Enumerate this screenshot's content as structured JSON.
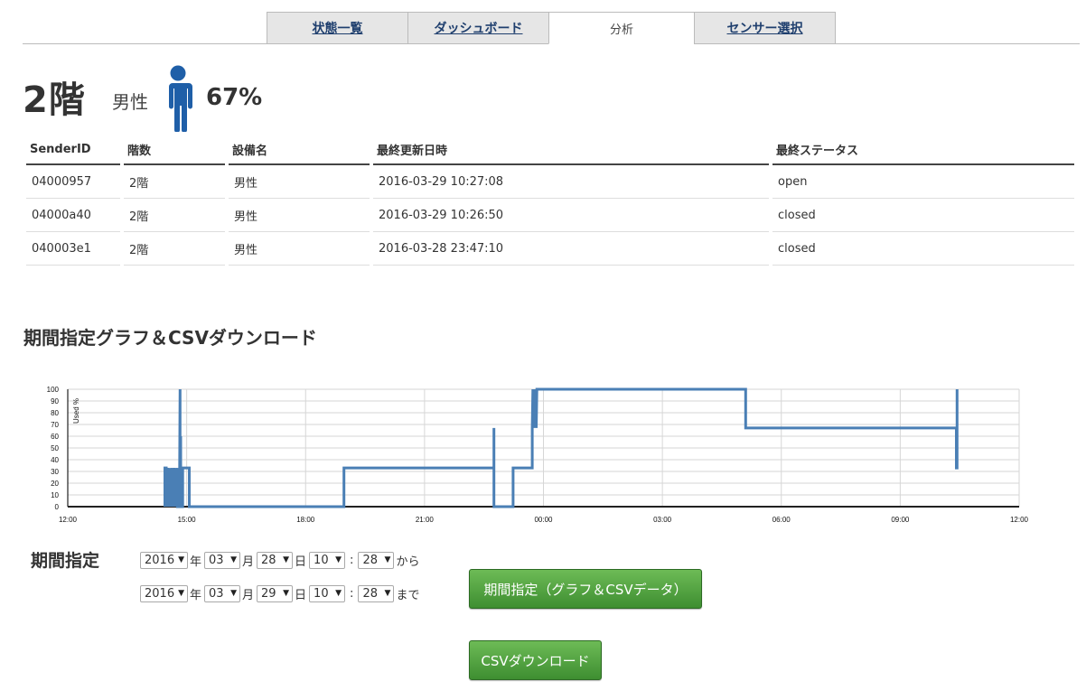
{
  "tabs": [
    {
      "label": "状態一覧"
    },
    {
      "label": "ダッシュボード"
    },
    {
      "label": "分析"
    },
    {
      "label": "センサー選択"
    }
  ],
  "header": {
    "floor": "2階",
    "gender": "男性",
    "percent": "67%"
  },
  "table": {
    "columns": [
      "SenderID",
      "階数",
      "設備名",
      "最終更新日時",
      "最終ステータス"
    ],
    "rows": [
      [
        "04000957",
        "2階",
        "男性",
        "2016-03-29 10:27:08",
        "open"
      ],
      [
        "04000a40",
        "2階",
        "男性",
        "2016-03-29 10:26:50",
        "closed"
      ],
      [
        "040003e1",
        "2階",
        "男性",
        "2016-03-28 23:47:10",
        "closed"
      ]
    ]
  },
  "section_title": "期間指定グラフ＆CSVダウンロード",
  "chart_data": {
    "type": "line",
    "ylabel": "Used %",
    "ylim": [
      0,
      100
    ],
    "yticks": [
      0,
      10,
      20,
      30,
      40,
      50,
      60,
      70,
      80,
      90,
      100
    ],
    "xlim": [
      0,
      1440
    ],
    "xticks": [
      {
        "t": 0,
        "label": "12:00"
      },
      {
        "t": 180,
        "label": "15:00"
      },
      {
        "t": 360,
        "label": "18:00"
      },
      {
        "t": 540,
        "label": "21:00"
      },
      {
        "t": 720,
        "label": "00:00"
      },
      {
        "t": 900,
        "label": "03:00"
      },
      {
        "t": 1080,
        "label": "06:00"
      },
      {
        "t": 1260,
        "label": "09:00"
      },
      {
        "t": 1440,
        "label": "12:00"
      }
    ],
    "grid": true,
    "color": "#4a7fb5",
    "series": [
      {
        "points": [
          [
            147,
            0
          ],
          [
            147,
            33
          ],
          [
            149,
            33
          ],
          [
            149,
            0
          ],
          [
            151,
            33
          ],
          [
            153,
            0
          ],
          [
            155,
            33
          ],
          [
            156,
            0
          ],
          [
            158,
            33
          ],
          [
            159,
            0
          ],
          [
            161,
            33
          ],
          [
            163,
            0
          ],
          [
            164,
            33
          ],
          [
            164,
            0
          ],
          [
            166,
            33
          ],
          [
            166,
            0
          ],
          [
            169,
            0
          ],
          [
            170,
            100
          ],
          [
            170,
            0
          ],
          [
            171,
            60
          ],
          [
            171,
            0
          ],
          [
            174,
            0
          ],
          [
            174,
            33
          ],
          [
            184,
            33
          ],
          [
            184,
            0
          ],
          [
            418,
            0
          ],
          [
            418,
            33
          ],
          [
            645,
            33
          ],
          [
            645,
            67
          ],
          [
            645,
            0
          ],
          [
            649,
            0
          ],
          [
            649,
            0
          ],
          [
            674,
            0
          ],
          [
            674,
            33
          ],
          [
            703,
            33
          ],
          [
            703,
            67
          ],
          [
            704,
            100
          ],
          [
            704,
            67
          ],
          [
            705,
            100
          ],
          [
            705,
            67
          ],
          [
            706,
            100
          ],
          [
            706,
            67
          ],
          [
            707,
            100
          ],
          [
            707,
            67
          ],
          [
            708,
            100
          ],
          [
            708,
            67
          ],
          [
            709,
            100
          ],
          [
            709,
            67
          ],
          [
            710,
            100
          ],
          [
            1026,
            100
          ],
          [
            1026,
            67
          ],
          [
            1345,
            67
          ],
          [
            1345,
            33
          ],
          [
            1346,
            33
          ],
          [
            1346,
            100
          ]
        ]
      }
    ]
  },
  "period": {
    "label": "期間指定",
    "from": {
      "year": "2016",
      "month": "03",
      "day": "28",
      "hour": "10",
      "minute": "28",
      "suffix": "から"
    },
    "to": {
      "year": "2016",
      "month": "03",
      "day": "29",
      "hour": "10",
      "minute": "28",
      "suffix": "まで"
    },
    "units": {
      "year": "年",
      "month": "月",
      "day": "日",
      "sep": ":"
    }
  },
  "buttons": {
    "graph_csv": "期間指定（グラフ＆CSVデータ）",
    "csv_download": "CSVダウンロード"
  }
}
